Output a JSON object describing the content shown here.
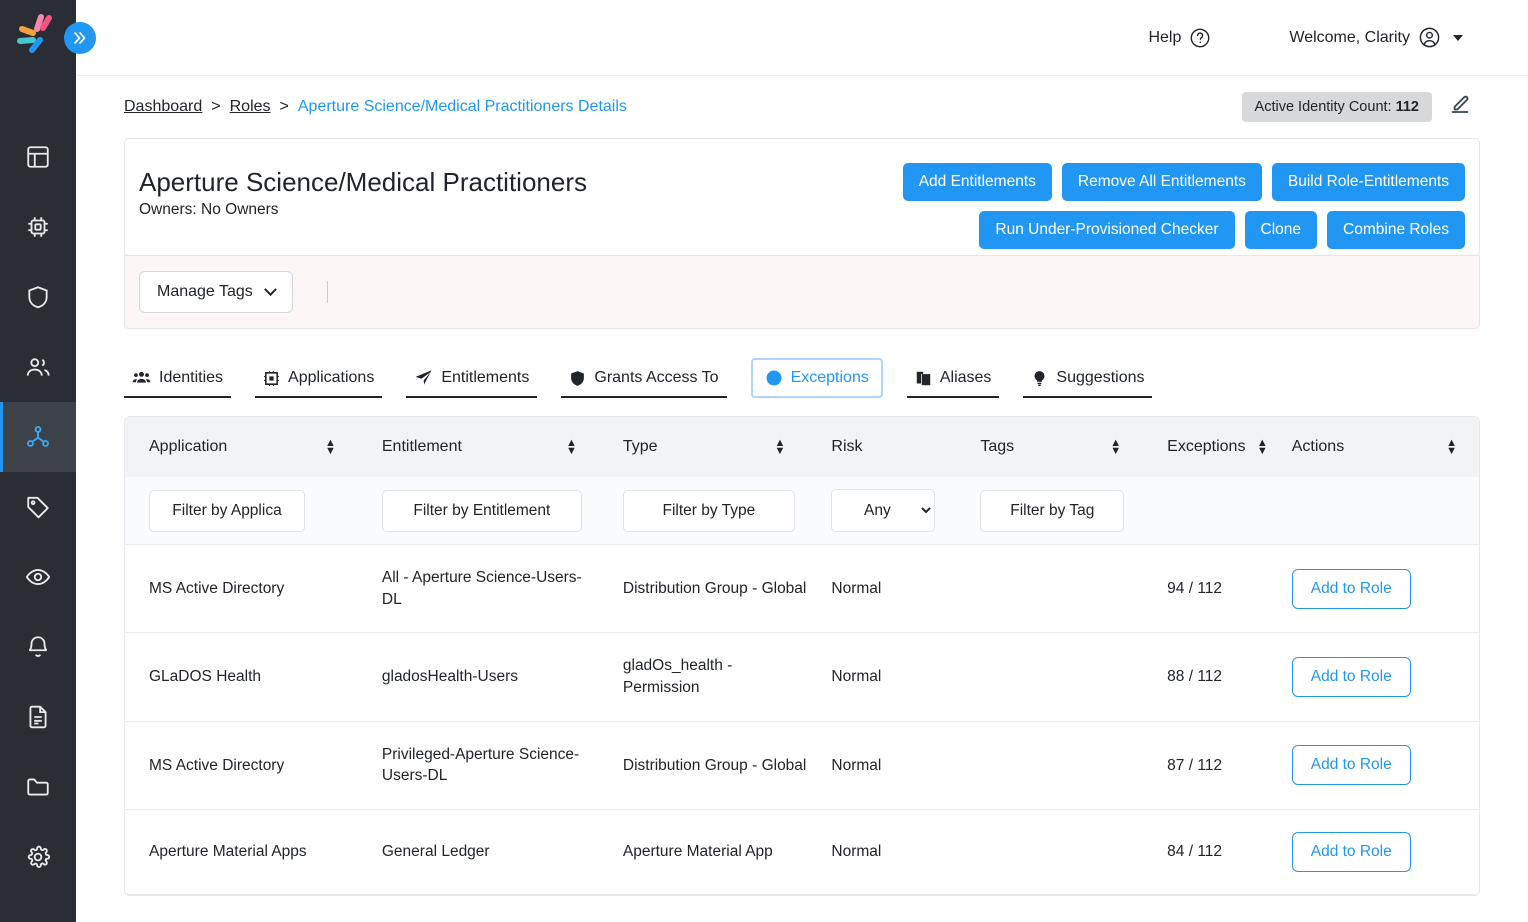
{
  "sidebar": {
    "logo_name": "clarity-logo",
    "collapse_label": "»",
    "items": [
      {
        "name": "dashboard",
        "icon": "layout-dashboard-icon",
        "active": false
      },
      {
        "name": "applications",
        "icon": "cpu-chip-icon",
        "active": false
      },
      {
        "name": "security",
        "icon": "shield-icon",
        "active": false
      },
      {
        "name": "identities",
        "icon": "users-icon",
        "active": false
      },
      {
        "name": "roles",
        "icon": "role-network-icon",
        "active": true
      },
      {
        "name": "tags",
        "icon": "tag-icon",
        "active": false
      },
      {
        "name": "visibility",
        "icon": "eye-icon",
        "active": false
      },
      {
        "name": "notifications",
        "icon": "bell-icon",
        "active": false
      },
      {
        "name": "reports",
        "icon": "document-icon",
        "active": false
      },
      {
        "name": "files",
        "icon": "folder-icon",
        "active": false
      },
      {
        "name": "settings",
        "icon": "gear-icon",
        "active": false
      }
    ]
  },
  "topbar": {
    "help_label": "Help",
    "help_icon": "question-circle-icon",
    "welcome_label": "Welcome, Clarity",
    "user_icon": "user-circle-icon"
  },
  "breadcrumb": {
    "items": [
      {
        "label": "Dashboard",
        "current": false
      },
      {
        "label": "Roles",
        "current": false
      },
      {
        "label": "Aperture Science/Medical Practitioners Details",
        "current": true
      }
    ],
    "separator": ">"
  },
  "identity_badge": {
    "label": "Active Identity Count:",
    "value": "112"
  },
  "edit_icon": "pencil-edit-icon",
  "role_header": {
    "title": "Aperture Science/Medical Practitioners",
    "owners": "Owners: No Owners",
    "buttons": [
      "Add Entitlements",
      "Remove All Entitlements",
      "Build Role-Entitlements",
      "Run Under-Provisioned Checker",
      "Clone",
      "Combine Roles"
    ]
  },
  "tags_bar": {
    "manage_tags_label": "Manage Tags"
  },
  "tabs": [
    {
      "label": "Identities",
      "icon": "users-group-icon",
      "active": false
    },
    {
      "label": "Applications",
      "icon": "cpu-chip-icon",
      "active": false
    },
    {
      "label": "Entitlements",
      "icon": "paper-plane-icon",
      "active": false
    },
    {
      "label": "Grants Access To",
      "icon": "shield-solid-icon",
      "active": false
    },
    {
      "label": "Exceptions",
      "icon": "no-entry-icon",
      "active": true
    },
    {
      "label": "Aliases",
      "icon": "copy-icon",
      "active": false
    },
    {
      "label": "Suggestions",
      "icon": "lightbulb-icon",
      "active": false
    }
  ],
  "table": {
    "columns": [
      {
        "label": "Application",
        "sortable": true
      },
      {
        "label": "Entitlement",
        "sortable": true
      },
      {
        "label": "Type",
        "sortable": true
      },
      {
        "label": "Risk",
        "sortable": false
      },
      {
        "label": "Tags",
        "sortable": true
      },
      {
        "label": "Exceptions",
        "sortable": true
      },
      {
        "label": "Actions",
        "sortable": true
      }
    ],
    "filters": {
      "application_placeholder": "Filter by Applica",
      "entitlement_placeholder": "Filter by Entitlement",
      "type_placeholder": "Filter by Type",
      "risk_selected": "Any",
      "risk_options": [
        "Any"
      ],
      "tag_placeholder": "Filter by Tag"
    },
    "action_label": "Add to Role",
    "rows": [
      {
        "application": "MS Active Directory",
        "entitlement": "All - Aperture Science-Users-DL",
        "type": "Distribution Group - Global",
        "risk": "Normal",
        "tags": "",
        "exceptions": "94 / 112",
        "action": "Add to Role"
      },
      {
        "application": "GLaDOS Health",
        "entitlement": "gladosHealth-Users",
        "type": "gladOs_health - Permission",
        "risk": "Normal",
        "tags": "",
        "exceptions": "88 / 112",
        "action": "Add to Role"
      },
      {
        "application": "MS Active Directory",
        "entitlement": "Privileged-Aperture Science-Users-DL",
        "type": "Distribution Group - Global",
        "risk": "Normal",
        "tags": "",
        "exceptions": "87 / 112",
        "action": "Add to Role"
      },
      {
        "application": "Aperture Material Apps",
        "entitlement": "General Ledger",
        "type": "Aperture Material App",
        "risk": "Normal",
        "tags": "",
        "exceptions": "84 / 112",
        "action": "Add to Role"
      }
    ]
  },
  "colors": {
    "accent": "#2196f3",
    "sidebar_bg": "#2a2e34",
    "tags_bar_bg": "#fdf6f6",
    "table_header_bg": "#f1f3f5",
    "badge_bg": "#d6d8da"
  }
}
